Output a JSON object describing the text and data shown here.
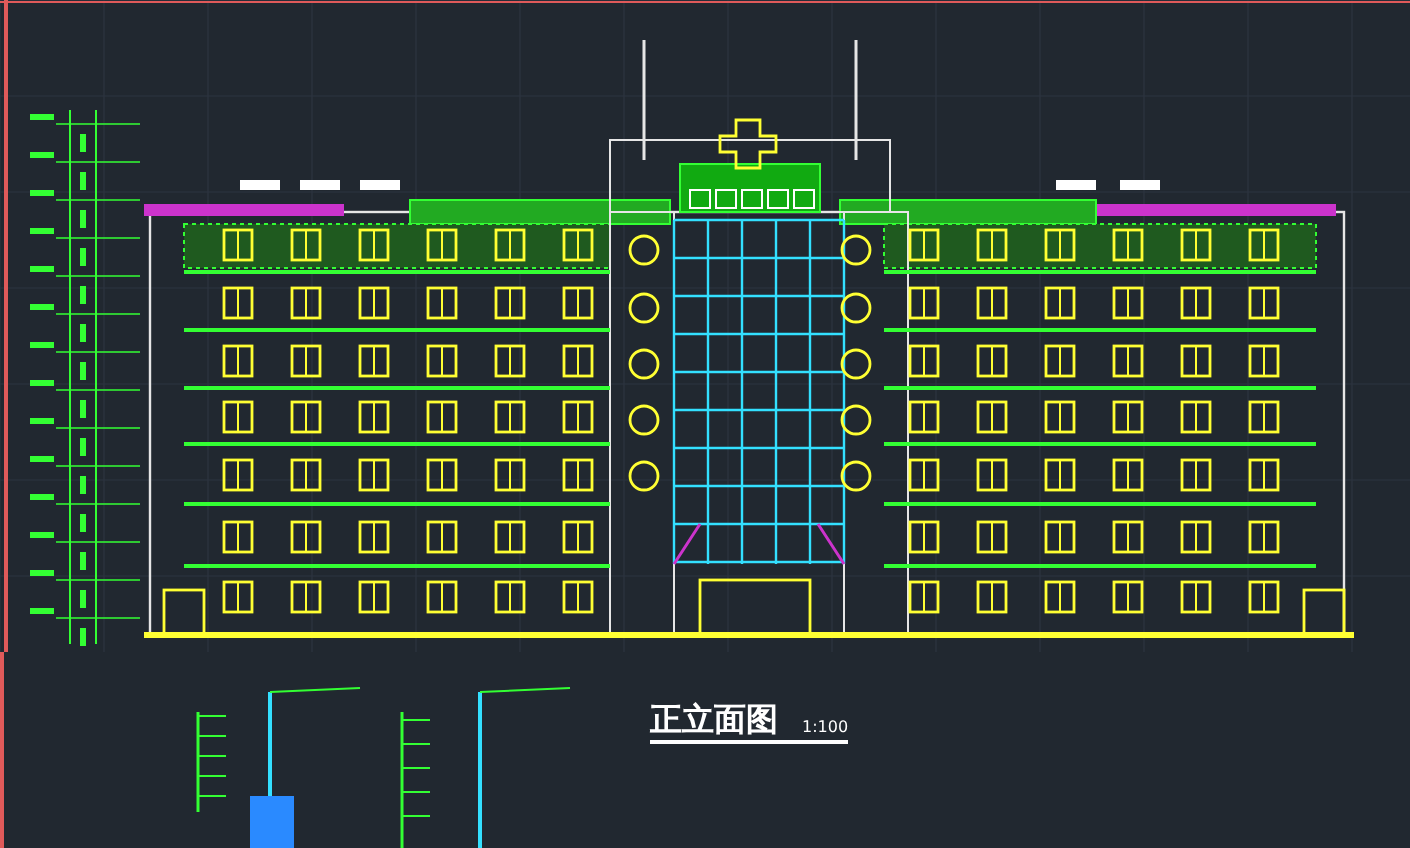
{
  "drawing_title": {
    "title": "正立面图",
    "scale": "1:100"
  }
}
